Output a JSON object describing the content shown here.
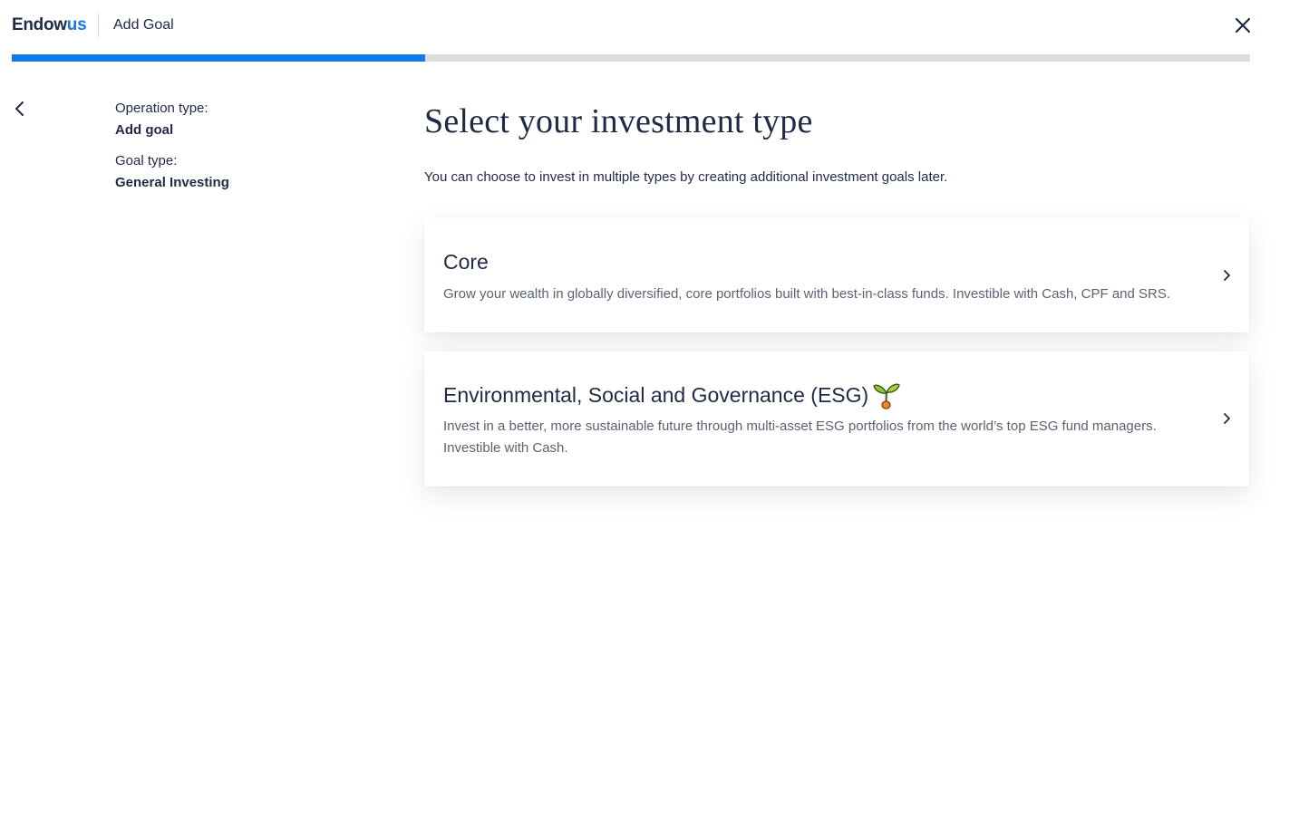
{
  "header": {
    "logo_primary": "Endow",
    "logo_accent": "us",
    "title": "Add Goal",
    "close_icon": "close-icon"
  },
  "progress": {
    "fraction": 0.334
  },
  "summary": {
    "operation_label": "Operation type:",
    "operation_value": "Add goal",
    "goal_label": "Goal type:",
    "goal_value": "General Investing"
  },
  "main": {
    "title": "Select your investment type",
    "subtitle": "You can choose to invest in multiple types by creating additional investment goals later.",
    "options": [
      {
        "title": "Core",
        "description": "Grow your wealth in globally diversified, core portfolios built with best-in-class funds. Investible with Cash, CPF and SRS.",
        "icon": "chevron-right-icon"
      },
      {
        "title": "Environmental, Social and Governance (ESG)",
        "description": "Invest in a better, more sustainable future through multi-asset ESG portfolios from the world’s top ESG fund managers. Investible with Cash.",
        "icon": "sprout-icon"
      }
    ]
  },
  "colors": {
    "brand_blue": "#1777e6",
    "text_dark": "#1f2a44",
    "text_muted": "#5b6272",
    "track_gray": "#dcdcdc"
  }
}
